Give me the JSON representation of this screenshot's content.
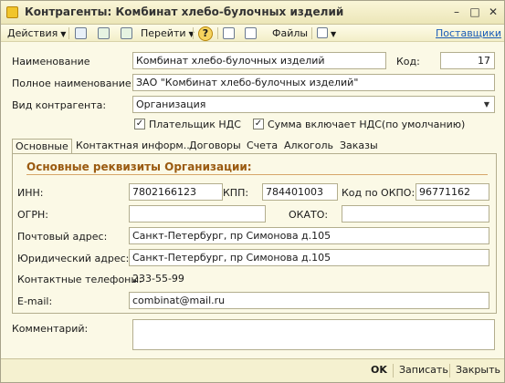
{
  "window": {
    "title": "Контрагенты: Комбинат хлебо-булочных изделий",
    "minimize": "–",
    "maximize": "□",
    "close": "✕"
  },
  "toolbar": {
    "actions": "Действия",
    "goto": "Перейти",
    "help": "?",
    "files": "Файлы",
    "suppliers": "Поставщики"
  },
  "form": {
    "name_label": "Наименование",
    "name_value": "Комбинат хлебо-булочных изделий",
    "code_label": "Код:",
    "code_value": "17",
    "fullname_label": "Полное наименование:",
    "fullname_value": "ЗАО \"Комбинат хлебо-булочных изделий\"",
    "kind_label": "Вид контрагента:",
    "kind_value": "Организация",
    "vat_payer_label": "Плательщик НДС",
    "vat_payer_checked": true,
    "vat_included_label": "Сумма включает НДС(по умолчанию)",
    "vat_included_checked": true
  },
  "tabs": [
    {
      "label": "Основные",
      "active": true
    },
    {
      "label": "Контактная информ...",
      "active": false
    },
    {
      "label": "Договоры",
      "active": false
    },
    {
      "label": "Счета",
      "active": false
    },
    {
      "label": "Алкоголь",
      "active": false
    },
    {
      "label": "Заказы",
      "active": false
    }
  ],
  "main": {
    "section_title": "Основные реквизиты Организации:",
    "inn_label": "ИНН:",
    "inn_value": "7802166123",
    "kpp_label": "КПП:",
    "kpp_value": "784401003",
    "okpo_label": "Код по ОКПО:",
    "okpo_value": "96771162",
    "ogrn_label": "ОГРН:",
    "ogrn_value": "",
    "okato_label": "ОКАТО:",
    "okato_value": "",
    "postal_label": "Почтовый адрес:",
    "postal_value": "Санкт-Петербург, пр Симонова д.105",
    "legal_label": "Юридический адрес:",
    "legal_value": "Санкт-Петербург, пр Симонова д.105",
    "phones_label": "Контактные телефоны:",
    "phones_value": "233-55-99",
    "email_label": "E-mail:",
    "email_value": "combinat@mail.ru"
  },
  "comment": {
    "label": "Комментарий:",
    "value": ""
  },
  "footer": {
    "ok": "OK",
    "save": "Записать",
    "close": "Закрыть"
  }
}
